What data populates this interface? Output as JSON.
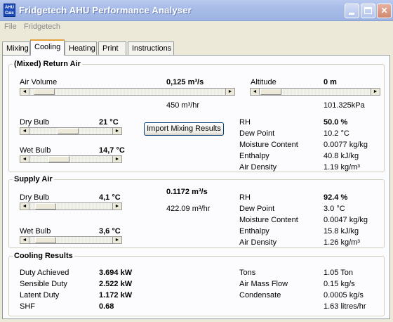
{
  "window": {
    "title": "Fridgetech AHU Performance Analyser",
    "icon_text": "AHU Calc"
  },
  "menu": {
    "file": "File",
    "fridgetech": "Fridgetech"
  },
  "tabs": [
    {
      "label": "Mixing"
    },
    {
      "label": "Cooling",
      "active": true
    },
    {
      "label": "Heating"
    },
    {
      "label": "Print"
    },
    {
      "label": "Instructions"
    }
  ],
  "return_air": {
    "legend": "(Mixed) Return Air",
    "air_volume_label": "Air Volume",
    "air_volume_value": "0,125 m³/s",
    "air_volume_hr": "450 m³/hr",
    "altitude_label": "Altitude",
    "altitude_value": "0 m",
    "pressure": "101.325kPa",
    "dry_bulb_label": "Dry Bulb",
    "dry_bulb_value": "21 °C",
    "wet_bulb_label": "Wet Bulb",
    "wet_bulb_value": "14,7 °C",
    "import_button": "Import Mixing Results",
    "props": [
      {
        "label": "RH",
        "value": "50.0 %",
        "bold": true
      },
      {
        "label": "Dew Point",
        "value": "10.2 °C"
      },
      {
        "label": "Moisture Content",
        "value": "0.0077 kg/kg"
      },
      {
        "label": "Enthalpy",
        "value": "40.8 kJ/kg"
      },
      {
        "label": "Air Density",
        "value": "1.19 kg/m³"
      }
    ]
  },
  "supply_air": {
    "legend": "Supply Air",
    "dry_bulb_label": "Dry Bulb",
    "dry_bulb_value": "4,1 °C",
    "wet_bulb_label": "Wet Bulb",
    "wet_bulb_value": "3,6 °C",
    "flow_value": "0.1172 m³/s",
    "flow_hr": "422.09 m³/hr",
    "props": [
      {
        "label": "RH",
        "value": "92.4 %",
        "bold": true
      },
      {
        "label": "Dew Point",
        "value": "3.0 °C"
      },
      {
        "label": "Moisture Content",
        "value": "0.0047 kg/kg"
      },
      {
        "label": "Enthalpy",
        "value": "15.8 kJ/kg"
      },
      {
        "label": "Air Density",
        "value": "1.26 kg/m³"
      }
    ]
  },
  "cooling_results": {
    "legend": "Cooling Results",
    "left": [
      {
        "label": "Duty Achieved",
        "value": "3.694 kW"
      },
      {
        "label": "Sensible Duty",
        "value": "2.522 kW"
      },
      {
        "label": "Latent Duty",
        "value": "1.172 kW"
      },
      {
        "label": "SHF",
        "value": "0.68"
      }
    ],
    "right": [
      {
        "label": "Tons",
        "value": "1.05 Ton"
      },
      {
        "label": "Air Mass Flow",
        "value": "0.15 kg/s"
      },
      {
        "label": "Condensate",
        "value": "0.0005 kg/s"
      },
      {
        "label": "",
        "value": "1.63 litres/hr"
      }
    ]
  },
  "sliders": {
    "air_volume": 0.02,
    "altitude": 0.0,
    "return_dry_bulb": 0.45,
    "return_wet_bulb": 0.3,
    "supply_dry_bulb": 0.08,
    "supply_wet_bulb": 0.08
  }
}
